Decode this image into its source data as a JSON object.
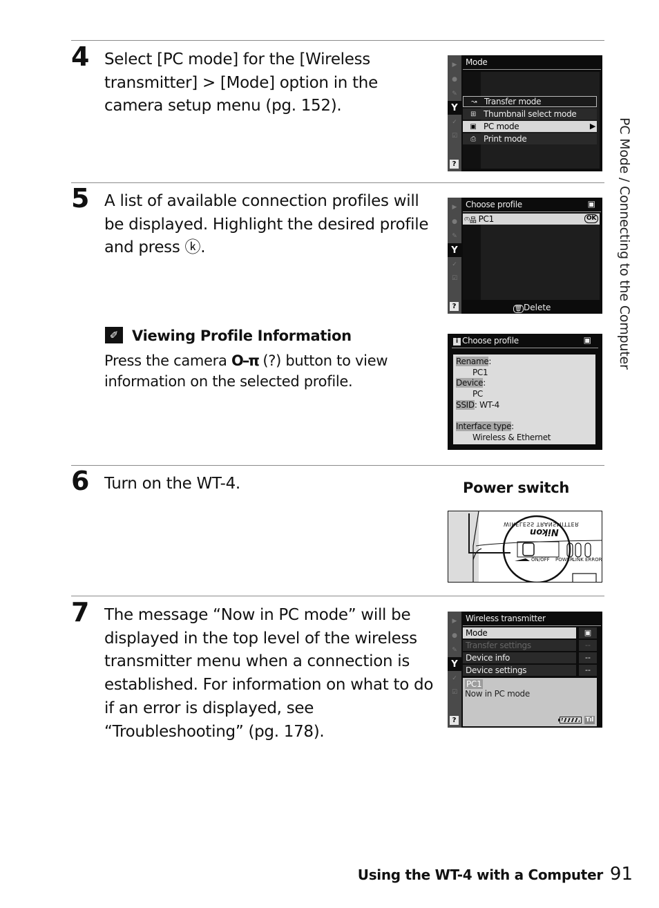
{
  "side_tab": "PC Mode / Connecting to the Computer",
  "steps": [
    {
      "number": "4",
      "text": "Select [PC mode] for the [Wireless transmitter] > [Mode] option in the camera setup menu (pg. 152)."
    },
    {
      "number": "5",
      "text": "A list of available connection profiles will be displayed.  Highlight the desired profile and press ⓚ."
    },
    {
      "number": "6",
      "text": "Turn on the WT-4."
    },
    {
      "number": "7",
      "text": "The message “Now in PC mode” will be displayed in the top level of the wireless transmitter menu when a connection is established.  For information on what to do if an error is displayed, see “Troubleshooting” (pg. 178)."
    }
  ],
  "step5_ok_symbol": "OK",
  "tip": {
    "icon": "paperclip-note-icon",
    "title": "Viewing Profile Information",
    "text_before": "Press the camera",
    "key_symbol": "O–π",
    "text_after": "(?) button to view information on the selected profile."
  },
  "screens": {
    "mode": {
      "title": "Mode",
      "items": [
        {
          "icon": "transfer-icon",
          "glyph": "↝",
          "label": "Transfer mode",
          "state": "outlined"
        },
        {
          "icon": "thumbnail-grid-icon",
          "glyph": "⊞",
          "label": "Thumbnail select mode",
          "state": "plain"
        },
        {
          "icon": "computer-icon",
          "glyph": "▣",
          "label": "PC mode",
          "state": "selected"
        },
        {
          "icon": "printer-icon",
          "glyph": "⎙",
          "label": "Print mode",
          "state": "plain"
        }
      ]
    },
    "choose_profile": {
      "title": "Choose profile",
      "profile_label": "PC1",
      "ok_badge": "OK",
      "footer_label": "Delete"
    },
    "profile_info": {
      "title": "Choose profile",
      "fields": [
        {
          "label": "Rename",
          "value": "PC1"
        },
        {
          "label": "Device",
          "value": "PC"
        },
        {
          "label": "SSID",
          "value": "WT-4"
        },
        {
          "label": "Interface type",
          "value": "Wireless & Ethernet"
        }
      ]
    },
    "wireless_transmitter": {
      "title": "Wireless transmitter",
      "items": [
        {
          "label": "Mode",
          "value": "▣",
          "state": "selected"
        },
        {
          "label": "Transfer settings",
          "value": "--",
          "state": "disabled"
        },
        {
          "label": "Device info",
          "value": "--",
          "state": "plain"
        },
        {
          "label": "Device settings",
          "value": "--",
          "state": "plain"
        }
      ],
      "status_profile": "PC1",
      "status_message": "Now in PC mode"
    }
  },
  "illustration": {
    "caption": "Power switch",
    "labels": [
      "ON/OFF",
      "POWER",
      "LINK",
      "ERROR"
    ],
    "brand_mirrored": "Nikon",
    "model_mirrored": "WIRELESS TRANSMITTER"
  },
  "footer": {
    "section": "Using the WT-4 with a Computer",
    "page_number": "91"
  }
}
